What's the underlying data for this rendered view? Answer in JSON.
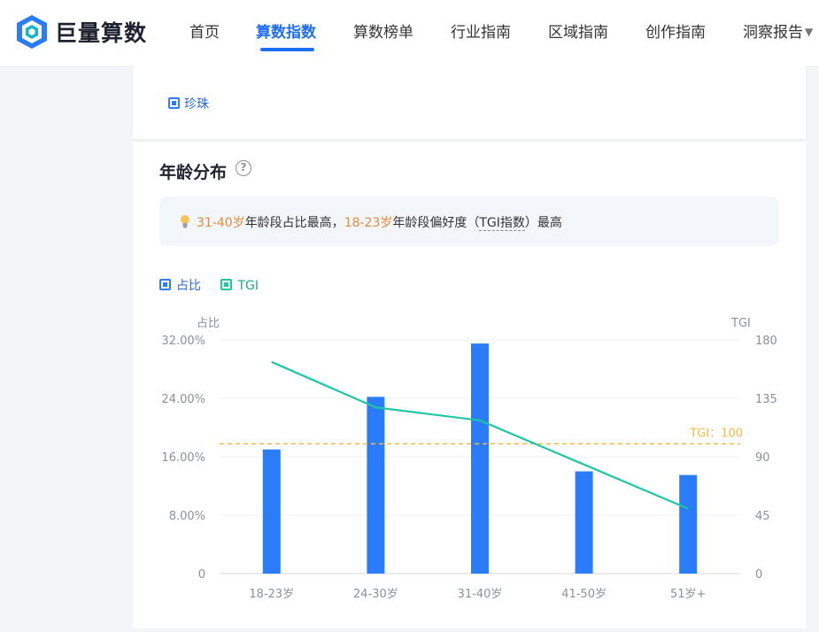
{
  "brand": {
    "name": "巨量算数"
  },
  "nav": {
    "items": [
      {
        "label": "首页",
        "active": false
      },
      {
        "label": "算数指数",
        "active": true
      },
      {
        "label": "算数榜单",
        "active": false
      },
      {
        "label": "行业指南",
        "active": false
      },
      {
        "label": "区域指南",
        "active": false
      },
      {
        "label": "创作指南",
        "active": false
      },
      {
        "label": "洞察报告",
        "active": false,
        "dropdown": true
      }
    ]
  },
  "top_card": {
    "legend_label": "珍珠"
  },
  "age_card": {
    "title": "年龄分布",
    "insight": {
      "highlight_1": "31-40岁",
      "text_1": "年龄段占比最高，",
      "highlight_2": "18-23岁",
      "text_2": "年龄段偏好度（",
      "tgi_term": "TGI指数",
      "text_3": "）最高"
    },
    "legend": {
      "share_label": "占比",
      "tgi_label": "TGI"
    }
  },
  "colors": {
    "accent": "#1e6ef4",
    "bar": "#2a7cf8",
    "tgi_line": "#1ec7a5",
    "reference": "#f5b942",
    "highlight": "#e8893a"
  },
  "chart_data": {
    "type": "bar",
    "categories": [
      "18-23岁",
      "24-30岁",
      "31-40岁",
      "41-50岁",
      "51岁+"
    ],
    "series": [
      {
        "name": "占比",
        "type": "bar",
        "axis": "left",
        "values": [
          17.0,
          24.2,
          31.5,
          14.0,
          13.5
        ]
      },
      {
        "name": "TGI",
        "type": "line",
        "axis": "right",
        "values": [
          163,
          128,
          118,
          84,
          50
        ]
      }
    ],
    "left_axis": {
      "title": "占比",
      "ticks": [
        "0",
        "8.00%",
        "16.00%",
        "24.00%",
        "32.00%"
      ],
      "ylim": [
        0,
        32
      ]
    },
    "right_axis": {
      "title": "TGI",
      "ticks": [
        "0",
        "45",
        "90",
        "135",
        "180"
      ],
      "ylim": [
        0,
        180
      ]
    },
    "reference_line": {
      "value": 100,
      "label": "TGI：100",
      "axis": "right"
    },
    "grid": true,
    "legend_position": "top-left"
  }
}
